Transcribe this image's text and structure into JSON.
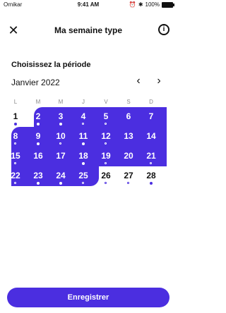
{
  "status_bar": {
    "carrier": "Ornikar",
    "time": "9:41 AM",
    "battery": "100%"
  },
  "header": {
    "title": "Ma semaine type",
    "close_icon": "close-icon",
    "info_icon": "info-icon"
  },
  "section": {
    "title": "Choisissez la période"
  },
  "calendar": {
    "month_label": "Janvier 2022",
    "weekdays": [
      "L",
      "M",
      "M",
      "J",
      "V",
      "S",
      "D"
    ],
    "accent_color": "#4b2ee0",
    "days": [
      {
        "n": "1",
        "selected": false,
        "dot": "filled"
      },
      {
        "n": "2",
        "selected": true,
        "dot": "filled"
      },
      {
        "n": "3",
        "selected": true,
        "dot": "filled"
      },
      {
        "n": "4",
        "selected": true,
        "dot": "hollow"
      },
      {
        "n": "5",
        "selected": true,
        "dot": "hollow"
      },
      {
        "n": "6",
        "selected": true,
        "dot": ""
      },
      {
        "n": "7",
        "selected": true,
        "dot": ""
      },
      {
        "n": "8",
        "selected": true,
        "dot": "hollow"
      },
      {
        "n": "9",
        "selected": true,
        "dot": "filled"
      },
      {
        "n": "10",
        "selected": true,
        "dot": "hollow"
      },
      {
        "n": "11",
        "selected": true,
        "dot": "filled"
      },
      {
        "n": "12",
        "selected": true,
        "dot": "hollow"
      },
      {
        "n": "13",
        "selected": true,
        "dot": ""
      },
      {
        "n": "14",
        "selected": true,
        "dot": ""
      },
      {
        "n": "15",
        "selected": true,
        "dot": "hollow"
      },
      {
        "n": "16",
        "selected": true,
        "dot": ""
      },
      {
        "n": "17",
        "selected": true,
        "dot": ""
      },
      {
        "n": "18",
        "selected": true,
        "dot": "filled"
      },
      {
        "n": "19",
        "selected": true,
        "dot": "hollow"
      },
      {
        "n": "20",
        "selected": true,
        "dot": ""
      },
      {
        "n": "21",
        "selected": true,
        "dot": "hollow"
      },
      {
        "n": "22",
        "selected": true,
        "dot": "hollow"
      },
      {
        "n": "23",
        "selected": true,
        "dot": "filled"
      },
      {
        "n": "24",
        "selected": true,
        "dot": "filled"
      },
      {
        "n": "25",
        "selected": true,
        "dot": "hollow"
      },
      {
        "n": "26",
        "selected": false,
        "dot": "hollow"
      },
      {
        "n": "27",
        "selected": false,
        "dot": "hollow"
      },
      {
        "n": "28",
        "selected": false,
        "dot": "filled"
      }
    ]
  },
  "save_button": {
    "label": "Enregistrer"
  }
}
